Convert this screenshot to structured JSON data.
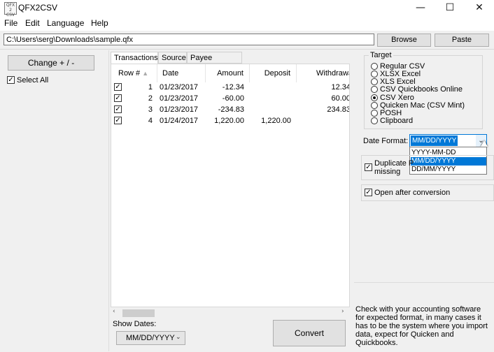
{
  "window": {
    "icon_text": "QFX\n2\nCSV",
    "title": "QFX2CSV",
    "minimize": "—",
    "maximize": "☐",
    "close": "✕"
  },
  "menu": [
    "File",
    "Edit",
    "Language",
    "Help"
  ],
  "path": {
    "value": "C:\\Users\\serg\\Downloads\\sample.qfx",
    "browse_label": "Browse",
    "paste_label": "Paste"
  },
  "left": {
    "change_label": "Change + / -",
    "select_all_label": "Select All",
    "select_all_checked": true
  },
  "tabs": [
    "Transactions",
    "Source",
    "Payee Mapping"
  ],
  "grid": {
    "columns": [
      "Row #",
      "Date",
      "Amount",
      "Deposit",
      "Withdrawal"
    ],
    "rows": [
      {
        "checked": true,
        "row": "1",
        "date": "01/23/2017",
        "amount": "-12.34",
        "deposit": "",
        "withdrawal": "12.34"
      },
      {
        "checked": true,
        "row": "2",
        "date": "01/23/2017",
        "amount": "-60.00",
        "deposit": "",
        "withdrawal": "60.00"
      },
      {
        "checked": true,
        "row": "3",
        "date": "01/23/2017",
        "amount": "-234.83",
        "deposit": "",
        "withdrawal": "234.83"
      },
      {
        "checked": true,
        "row": "4",
        "date": "01/24/2017",
        "amount": "1,220.00",
        "deposit": "1,220.00",
        "withdrawal": ""
      }
    ]
  },
  "bottom": {
    "show_dates_label": "Show Dates:",
    "show_dates_value": "MM/DD/YYYY",
    "convert_label": "Convert"
  },
  "target": {
    "label": "Target",
    "options": [
      "Regular CSV",
      "XLSX Excel",
      "XLS Excel",
      "CSV Quickbooks Online",
      "CSV Xero",
      "Quicken Mac (CSV Mint)",
      "POSH",
      "Clipboard"
    ],
    "selected": "CSV Xero"
  },
  "date_format": {
    "label": "Date Format:",
    "value": "MM/DD/YYYY",
    "options": [
      "YYYY-MM-DD",
      "MM/DD/YYYY",
      "DD/MM/YYYY"
    ],
    "highlighted": "MM/DD/YYYY"
  },
  "options": {
    "duplicate_label_1": "Duplicate P",
    "duplicate_label_2": "missing",
    "duplicate_checked": true,
    "open_after_label": "Open after conversion",
    "open_after_checked": true
  },
  "info_text": "Check with your accounting software for expected format, in many cases it has to be the system where you import data, expect for Quicken and Quickbooks.",
  "colors": {
    "highlight": "#0078d7"
  }
}
